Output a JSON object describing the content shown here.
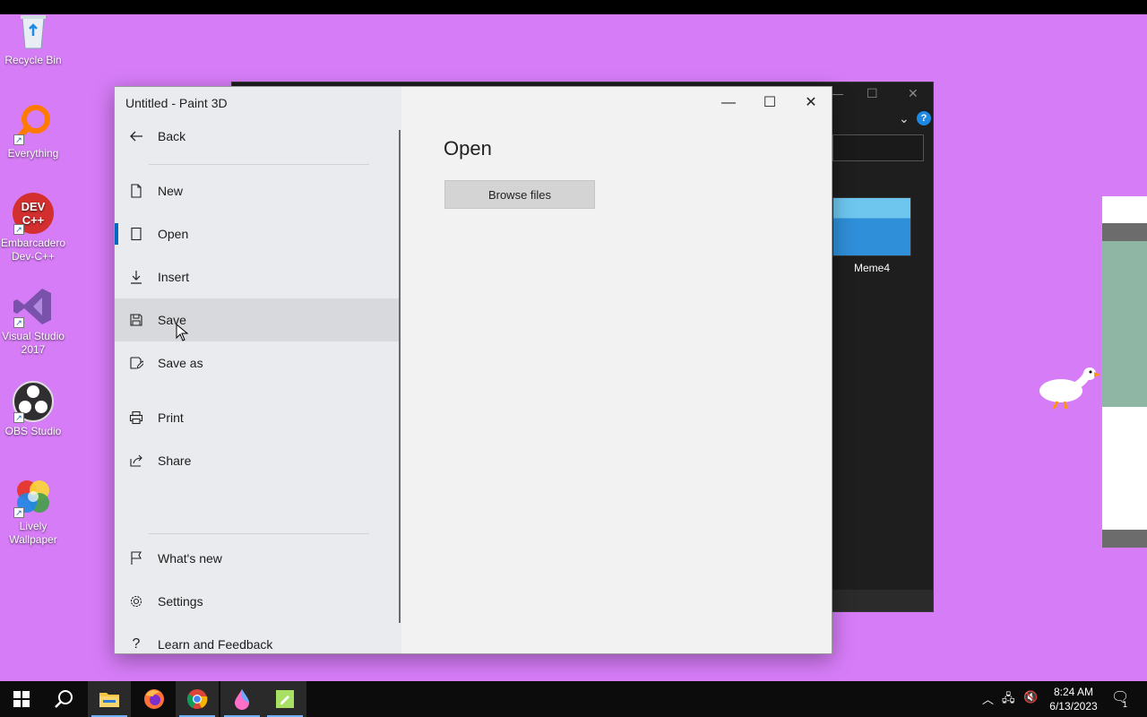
{
  "desktop": {
    "icons": [
      {
        "label": "Recycle Bin",
        "icon": "recycle-bin-icon"
      },
      {
        "label": "Everything",
        "icon": "everything-search-icon"
      },
      {
        "label": "Embarcadero Dev-C++",
        "icon": "devcpp-icon"
      },
      {
        "label": "Visual Studio 2017",
        "icon": "visual-studio-icon"
      },
      {
        "label": "OBS Studio",
        "icon": "obs-icon"
      },
      {
        "label": "Lively Wallpaper",
        "icon": "lively-wallpaper-icon"
      }
    ],
    "background_color": "#d67cf7"
  },
  "explorer": {
    "thumbnail_label": "Meme4",
    "help_label": "?"
  },
  "paint3d": {
    "title": "Untitled - Paint 3D",
    "back_label": "Back",
    "menu": [
      {
        "label": "New",
        "icon": "new-file-icon"
      },
      {
        "label": "Open",
        "icon": "open-icon"
      },
      {
        "label": "Insert",
        "icon": "insert-icon"
      },
      {
        "label": "Save",
        "icon": "save-icon"
      },
      {
        "label": "Save as",
        "icon": "save-as-icon"
      },
      {
        "label": "Print",
        "icon": "print-icon"
      },
      {
        "label": "Share",
        "icon": "share-icon"
      },
      {
        "label": "What's new",
        "icon": "flag-icon"
      },
      {
        "label": "Settings",
        "icon": "gear-icon"
      },
      {
        "label": "Learn and Feedback",
        "icon": "help-icon"
      }
    ],
    "selected_item": "Open",
    "hovered_item": "Save",
    "main_heading": "Open",
    "browse_button": "Browse files",
    "accent_color": "#0067c0"
  },
  "taskbar": {
    "apps": [
      "start-icon",
      "search-icon",
      "file-explorer-icon",
      "firefox-icon",
      "chrome-icon",
      "paint3d-icon",
      "notepad-icon"
    ],
    "time": "8:24 AM",
    "date": "6/13/2023",
    "notification_count": "1"
  }
}
